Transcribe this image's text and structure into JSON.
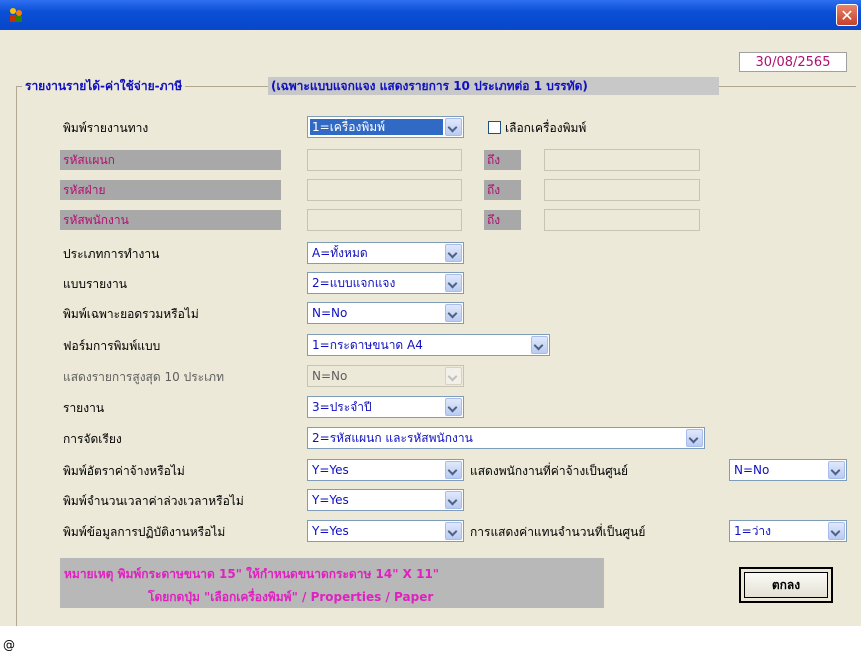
{
  "window": {
    "close_glyph": "✕"
  },
  "date": "30/08/2565",
  "group": {
    "title": "รายงานรายได้-ค่าใช้จ่าย-ภาษี",
    "subtitle": "(เฉพาะแบบแจกแจง แสดงรายการ 10 ประเภทต่อ 1 บรรทัด)"
  },
  "labels": {
    "print_via": "พิมพ์รายงานทาง",
    "select_printer": "เลือกเครื่องพิมพ์",
    "dept_code": "รหัสแผนก",
    "div_code": "รหัสฝ่าย",
    "emp_code": "รหัสพนักงาน",
    "to": "ถึง",
    "work_type": "ประเภทการทำงาน",
    "report_format": "แบบรายงาน",
    "totals_only": "พิมพ์เฉพาะยอดรวมหรือไม่",
    "print_form": "ฟอร์มการพิมพ์แบบ",
    "top10": "แสดงรายการสูงสุด 10 ประเภท",
    "report": "รายงาน",
    "sorting": "การจัดเรียง",
    "print_wage_rate": "พิมพ์อัตราค่าจ้างหรือไม่",
    "show_zero_wage": "แสดงพนักงานที่ค่าจ้างเป็นศูนย์",
    "print_ot_hours": "พิมพ์จำนวนเวลาค่าล่วงเวลาหรือไม่",
    "print_attendance": "พิมพ์ข้อมูลการปฏิบัติงานหรือไม่",
    "zero_display": "การแสดงค่าแทนจำนวนที่เป็นศูนย์"
  },
  "values": {
    "print_via": "1=เครื่องพิมพ์",
    "work_type": "A=ทั้งหมด",
    "report_format": "2=แบบแจกแจง",
    "totals_only": "N=No",
    "print_form": "1=กระดาษขนาด A4",
    "top10": "N=No",
    "report": "3=ประจำปี",
    "sorting": "2=รหัสแผนก และรหัสพนักงาน",
    "print_wage_rate": "Y=Yes",
    "show_zero_wage": "N=No",
    "print_ot_hours": "Y=Yes",
    "print_attendance": "Y=Yes",
    "zero_display": "1=ว่าง"
  },
  "note": {
    "line1": "หมายเหตุ   พิมพ์กระดาษขนาด 15\" ให้กำหนดขนาดกระดาษ 14\" X 11\"",
    "line2": "โดยกดปุ่ม \"เลือกเครื่องพิมพ์\" / Properties / Paper"
  },
  "ok_button": "ตกลง",
  "status_char": "@"
}
